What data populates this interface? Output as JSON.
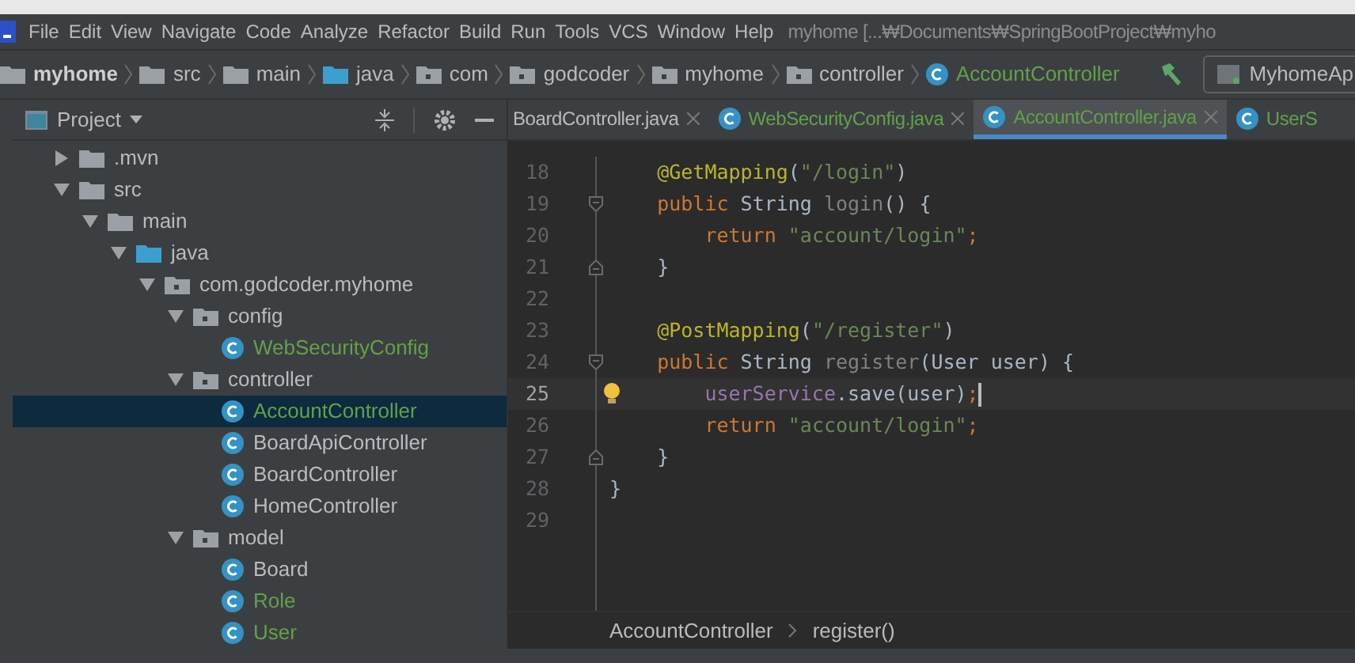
{
  "menu": [
    "File",
    "Edit",
    "View",
    "Navigate",
    "Code",
    "Analyze",
    "Refactor",
    "Build",
    "Run",
    "Tools",
    "VCS",
    "Window",
    "Help"
  ],
  "window": {
    "title": "myhome [...₩Documents₩SpringBootProject₩myho"
  },
  "breadcrumb": [
    {
      "label": "myhome",
      "kind": "module"
    },
    {
      "label": "src",
      "kind": "folder"
    },
    {
      "label": "main",
      "kind": "folder"
    },
    {
      "label": "java",
      "kind": "source"
    },
    {
      "label": "com",
      "kind": "package"
    },
    {
      "label": "godcoder",
      "kind": "package"
    },
    {
      "label": "myhome",
      "kind": "package"
    },
    {
      "label": "controller",
      "kind": "package"
    },
    {
      "label": "AccountController",
      "kind": "class"
    }
  ],
  "run_config": {
    "label": "MyhomeAp"
  },
  "project_panel": {
    "title": "Project"
  },
  "tabs": [
    {
      "label": "BoardController.java",
      "icon": false,
      "changed": false,
      "selected": false
    },
    {
      "label": "WebSecurityConfig.java",
      "icon": true,
      "changed": true,
      "selected": false
    },
    {
      "label": "AccountController.java",
      "icon": true,
      "changed": true,
      "selected": true
    },
    {
      "label": "UserS",
      "icon": true,
      "changed": true,
      "selected": false
    }
  ],
  "tree": [
    {
      "label": ".mvn",
      "kind": "folder",
      "expanded": false,
      "changed": false,
      "selected": false
    },
    {
      "label": "src",
      "kind": "folder",
      "expanded": true,
      "changed": false,
      "selected": false,
      "children": [
        {
          "label": "main",
          "kind": "folder",
          "expanded": true,
          "changed": false,
          "selected": false,
          "children": [
            {
              "label": "java",
              "kind": "source",
              "expanded": true,
              "changed": false,
              "selected": false,
              "children": [
                {
                  "label": "com.godcoder.myhome",
                  "kind": "package",
                  "expanded": true,
                  "changed": false,
                  "selected": false,
                  "children": [
                    {
                      "label": "config",
                      "kind": "package",
                      "expanded": true,
                      "changed": false,
                      "selected": false,
                      "children": [
                        {
                          "label": "WebSecurityConfig",
                          "kind": "class",
                          "changed": true,
                          "selected": false
                        }
                      ]
                    },
                    {
                      "label": "controller",
                      "kind": "package",
                      "expanded": true,
                      "changed": false,
                      "selected": false,
                      "children": [
                        {
                          "label": "AccountController",
                          "kind": "class",
                          "changed": true,
                          "selected": true
                        },
                        {
                          "label": "BoardApiController",
                          "kind": "class",
                          "changed": false,
                          "selected": false
                        },
                        {
                          "label": "BoardController",
                          "kind": "class",
                          "changed": false,
                          "selected": false
                        },
                        {
                          "label": "HomeController",
                          "kind": "class",
                          "changed": false,
                          "selected": false
                        }
                      ]
                    },
                    {
                      "label": "model",
                      "kind": "package",
                      "expanded": true,
                      "changed": false,
                      "selected": false,
                      "children": [
                        {
                          "label": "Board",
                          "kind": "class",
                          "changed": false,
                          "selected": false
                        },
                        {
                          "label": "Role",
                          "kind": "class",
                          "changed": true,
                          "selected": false
                        },
                        {
                          "label": "User",
                          "kind": "class",
                          "changed": true,
                          "selected": false
                        }
                      ]
                    }
                  ]
                }
              ]
            }
          ]
        }
      ]
    }
  ],
  "code": [
    {
      "number": "18",
      "fold_start": false,
      "fold_end": false,
      "current": false,
      "bulb": false,
      "tokens": [
        {
          "text": "    @GetMapping",
          "kind": "annotation"
        },
        {
          "text": "(",
          "kind": "plain"
        },
        {
          "text": "\"/login\"",
          "kind": "string"
        },
        {
          "text": ")",
          "kind": "plain"
        }
      ]
    },
    {
      "number": "19",
      "fold_start": true,
      "fold_end": false,
      "current": false,
      "bulb": false,
      "tokens": [
        {
          "text": "    public ",
          "kind": "keyword"
        },
        {
          "text": "String ",
          "kind": "plain"
        },
        {
          "text": "login",
          "kind": "unused"
        },
        {
          "text": "() {",
          "kind": "plain"
        }
      ]
    },
    {
      "number": "20",
      "fold_start": false,
      "fold_end": false,
      "current": false,
      "bulb": false,
      "tokens": [
        {
          "text": "        return ",
          "kind": "keyword"
        },
        {
          "text": "\"account/login\"",
          "kind": "string"
        },
        {
          "text": ";",
          "kind": "keyword"
        }
      ]
    },
    {
      "number": "21",
      "fold_start": false,
      "fold_end": true,
      "current": false,
      "bulb": false,
      "tokens": [
        {
          "text": "    }",
          "kind": "plain"
        }
      ]
    },
    {
      "number": "22",
      "fold_start": false,
      "fold_end": false,
      "current": false,
      "bulb": false
    },
    {
      "number": "23",
      "fold_start": false,
      "fold_end": false,
      "current": false,
      "bulb": false,
      "tokens": [
        {
          "text": "    @PostMapping",
          "kind": "annotation"
        },
        {
          "text": "(",
          "kind": "plain"
        },
        {
          "text": "\"/register\"",
          "kind": "string"
        },
        {
          "text": ")",
          "kind": "plain"
        }
      ]
    },
    {
      "number": "24",
      "fold_start": true,
      "fold_end": false,
      "current": false,
      "bulb": false,
      "tokens": [
        {
          "text": "    public ",
          "kind": "keyword"
        },
        {
          "text": "String ",
          "kind": "plain"
        },
        {
          "text": "register",
          "kind": "unused"
        },
        {
          "text": "(User user) {",
          "kind": "plain"
        }
      ]
    },
    {
      "number": "25",
      "fold_start": false,
      "fold_end": false,
      "current": true,
      "bulb": true,
      "tokens": [
        {
          "text": "        userService",
          "kind": "field"
        },
        {
          "text": ".save(user)",
          "kind": "plain"
        },
        {
          "text": ";",
          "kind": "keyword"
        }
      ]
    },
    {
      "number": "26",
      "fold_start": false,
      "fold_end": false,
      "current": false,
      "bulb": false,
      "tokens": [
        {
          "text": "        return ",
          "kind": "keyword"
        },
        {
          "text": "\"account/login\"",
          "kind": "string"
        },
        {
          "text": ";",
          "kind": "keyword"
        }
      ]
    },
    {
      "number": "27",
      "fold_start": false,
      "fold_end": true,
      "current": false,
      "bulb": false,
      "tokens": [
        {
          "text": "    }",
          "kind": "plain"
        }
      ]
    },
    {
      "number": "28",
      "fold_start": false,
      "fold_end": false,
      "current": false,
      "bulb": false,
      "tokens": [
        {
          "text": "}",
          "kind": "plain"
        }
      ]
    },
    {
      "number": "29",
      "fold_start": false,
      "fold_end": false,
      "current": false,
      "bulb": false
    }
  ],
  "editor_breadcrumb": [
    "AccountController",
    "register()"
  ]
}
